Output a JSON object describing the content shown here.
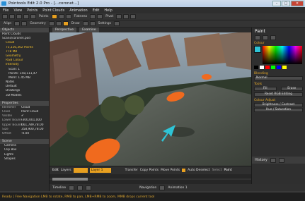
{
  "window": {
    "title": "Pointools Edit 2.0 Pro - [...coronet...]"
  },
  "menu": [
    "File",
    "View",
    "Points",
    "Point Clouds",
    "Animation",
    "Edit",
    "Help"
  ],
  "toolbar": {
    "labels": [
      "Points",
      "Flatness",
      "Pivot",
      "Align",
      "Geometry",
      "Draw",
      "Settings"
    ]
  },
  "scene": {
    "header": "Objects",
    "items": [
      {
        "label": "Point Clouds",
        "cls": ""
      },
      {
        "label": "Scans/coronet.pod",
        "cls": ""
      },
      {
        "label": "Cloud",
        "cls": "yel"
      },
      {
        "label": "73,116,302 Points",
        "cls": "yel"
      },
      {
        "label": "778 MB",
        "cls": "yel"
      },
      {
        "label": "Geometry",
        "cls": "yel"
      },
      {
        "label": "RGB Colour",
        "cls": "yel"
      },
      {
        "label": "Intensity",
        "cls": "yel"
      },
      {
        "label": "Scan: 1",
        "cls": ""
      },
      {
        "label": "Points: 158,111,47",
        "cls": ""
      },
      {
        "label": "Mem: 1.45 MB",
        "cls": ""
      },
      {
        "label": "Notes",
        "cls": ""
      },
      {
        "label": "Default",
        "cls": ""
      },
      {
        "label": "Drawings",
        "cls": ""
      },
      {
        "label": "3D Models",
        "cls": ""
      }
    ]
  },
  "props": {
    "rows": [
      {
        "k": "Identifier",
        "v": "Cloud"
      },
      {
        "k": "Class",
        "v": "Point Cloud"
      },
      {
        "k": "Visible",
        "v": "✔"
      },
      {
        "k": "Lower Bound",
        "v": "-300,001,000"
      },
      {
        "k": "Upper Bound",
        "v": "661,789,78.00"
      },
      {
        "k": "Size",
        "v": "358,900,78.00"
      },
      {
        "k": "Offset",
        "v": "-0.00"
      }
    ]
  },
  "bottomtree": [
    "Camera",
    "Clip Box",
    "Lights",
    "Shapes"
  ],
  "viewport": {
    "tabs": [
      "Perspective",
      "Examine"
    ]
  },
  "paint": {
    "title": "Paint",
    "colour_header": "Colour",
    "blending_header": "Blending",
    "blend_mode": "Normal",
    "tools_header": "Tools",
    "fill": "Fill",
    "erase": "Erase",
    "reset": "Reset RGB Editing",
    "colour_adjust_header": "Colour Adjust",
    "brightness": "Brightness / Contrast",
    "hue": "Hue / Saturation",
    "history": "History",
    "accent": "#2ec4d6"
  },
  "editbar": {
    "edit": "Edit",
    "layers": "Layers",
    "layer_name": "Layer 1",
    "transfer": "Transfer",
    "copy": "Copy Points",
    "move": "Move Points",
    "auto": "Auto Deselect",
    "select": "Select",
    "paint": "Paint"
  },
  "timeline": {
    "label": "Timeline",
    "navigation": "Navigation",
    "animation": "Animation 1"
  },
  "status": "Ready | Free Navigation  LMB to rotate, RMB to pan, LMB+RMB to zoom, MMB drops current tool"
}
